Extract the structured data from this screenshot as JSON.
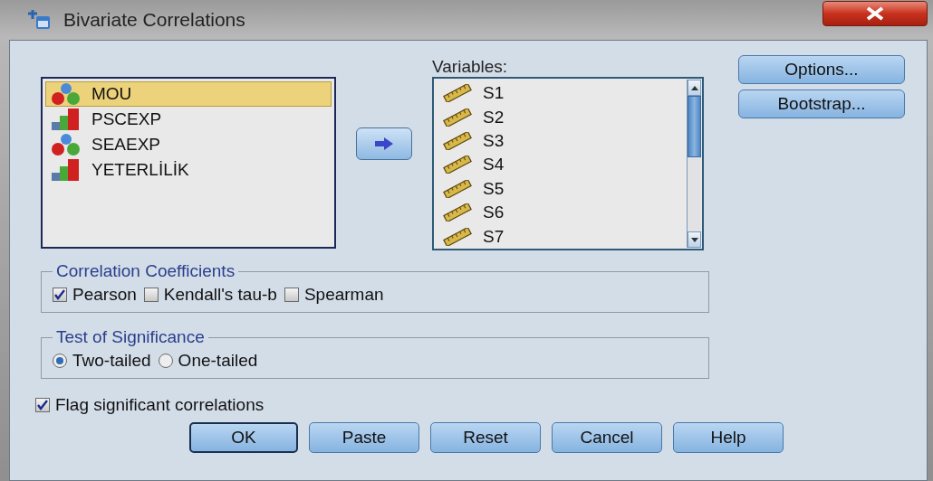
{
  "window": {
    "title": "Bivariate Correlations"
  },
  "source_list": {
    "items": [
      {
        "name": "MOU",
        "kind": "nominal",
        "selected": true
      },
      {
        "name": "PSCEXP",
        "kind": "ordinal",
        "selected": false
      },
      {
        "name": "SEAEXP",
        "kind": "nominal",
        "selected": false
      },
      {
        "name": "YETERLİLİK",
        "kind": "ordinal",
        "selected": false
      }
    ]
  },
  "variables": {
    "label": "Variables:",
    "items": [
      {
        "name": "S1",
        "kind": "scale",
        "selected": false
      },
      {
        "name": "S2",
        "kind": "scale",
        "selected": false
      },
      {
        "name": "S3",
        "kind": "scale",
        "selected": false
      },
      {
        "name": "S4",
        "kind": "scale",
        "selected": false
      },
      {
        "name": "S5",
        "kind": "scale",
        "selected": false
      },
      {
        "name": "S6",
        "kind": "scale",
        "selected": false
      },
      {
        "name": "S7",
        "kind": "scale",
        "selected": false
      }
    ]
  },
  "side_buttons": [
    "Options...",
    "Bootstrap..."
  ],
  "correlation_coefficients": {
    "title": "Correlation Coefficients",
    "options": [
      {
        "label": "Pearson",
        "checked": true
      },
      {
        "label": "Kendall's tau-b",
        "checked": false
      },
      {
        "label": "Spearman",
        "checked": false
      }
    ]
  },
  "test_of_significance": {
    "title": "Test of Significance",
    "options": [
      {
        "label": "Two-tailed",
        "selected": true
      },
      {
        "label": "One-tailed",
        "selected": false
      }
    ]
  },
  "flag_significant": {
    "label": "Flag significant correlations",
    "checked": true
  },
  "buttons": [
    {
      "label": "OK",
      "default": true
    },
    {
      "label": "Paste",
      "default": false
    },
    {
      "label": "Reset",
      "default": false
    },
    {
      "label": "Cancel",
      "default": false
    },
    {
      "label": "Help",
      "default": false
    }
  ]
}
